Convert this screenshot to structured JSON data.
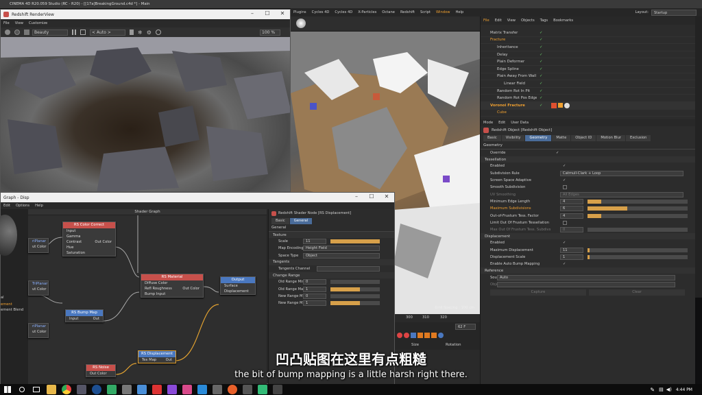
{
  "c4d": {
    "title": "CINEMA 4D R20.059 Studio (RC - R20) - [[17a]BreakingGround.c4d *] - Main",
    "menu": [
      "Plugins",
      "Cycles 4D",
      "Cycles 4D",
      "X-Particles",
      "Octane",
      "Redshift",
      "Script",
      "Window",
      "Help"
    ],
    "layout_label": "Layout:",
    "layout_value": "Startup",
    "grid_spacing": "Grid Spacing : 100 cm"
  },
  "renderview": {
    "title": "Redshift RenderView",
    "menu": [
      "File",
      "View",
      "Customize"
    ],
    "aov": "Beauty",
    "camera": "< Auto >",
    "zoom": "100 %"
  },
  "object_manager": {
    "menu": [
      "File",
      "Edit",
      "View",
      "Objects",
      "Tags",
      "Bookmarks"
    ],
    "objects": [
      {
        "name": "Matrix Transfer"
      },
      {
        "name": "Fracture"
      },
      {
        "name": "Inheritance"
      },
      {
        "name": "Delay"
      },
      {
        "name": "Plain Deformer"
      },
      {
        "name": "Edge Spline"
      },
      {
        "name": "Plain Away From Wall"
      },
      {
        "name": "Linear Field"
      },
      {
        "name": "Random Rot In Pit"
      },
      {
        "name": "Random Rot Pos Edge"
      },
      {
        "name": "Voronoi Fracture"
      },
      {
        "name": "Cube"
      }
    ]
  },
  "attributes": {
    "menu": [
      "Mode",
      "Edit",
      "User Data"
    ],
    "object_title": "Redshift Object [Redshift Object]",
    "tabs": [
      "Basic",
      "Visibility",
      "Geometry",
      "Matte",
      "Object ID",
      "Motion Blur",
      "Exclusion"
    ],
    "section": "Geometry",
    "override": "Override",
    "tessellation_header": "Tessellation",
    "tess_rows": [
      {
        "label": "Enabled",
        "value": "✓"
      },
      {
        "label": "Subdivision Rule",
        "value": "Catmull-Clark + Loop"
      },
      {
        "label": "Screen Space Adaptive",
        "value": "✓"
      },
      {
        "label": "Smooth Subdivision",
        "value": ""
      },
      {
        "label": "UV Smoothing",
        "value": "All Edges"
      },
      {
        "label": "Minimum Edge Length",
        "value": "4"
      },
      {
        "label": "Maximum Subdivisions",
        "value": "6"
      },
      {
        "label": "Out-of-Frustum Tess. Factor",
        "value": "4"
      },
      {
        "label": "Limit Out Of Frustum Tessellation",
        "value": ""
      },
      {
        "label": "Max Out Of Frustum Tess. Subdivs",
        "value": "0"
      }
    ],
    "displacement_header": "Displacement",
    "disp_rows": [
      {
        "label": "Enabled",
        "value": "✓"
      },
      {
        "label": "Maximum Displacement",
        "value": "11"
      },
      {
        "label": "Displacement Scale",
        "value": "1"
      },
      {
        "label": "Enable Auto Bump Mapping",
        "value": "✓"
      }
    ],
    "reference_header": "Reference",
    "ref_source_label": "Source",
    "ref_source_value": "Auto",
    "ref_object_label": "Object",
    "capture": "Capture",
    "clear": "Clear"
  },
  "shader_graph": {
    "title": "Graph - Disp",
    "menu": [
      "Edit",
      "Options",
      "Help"
    ],
    "panel_title": "Shader Graph",
    "left_labels": [
      "riPlanar",
      "ut Color",
      "TriPlanar",
      "ut Color",
      "riPlanar",
      "ut Color"
    ],
    "side_labels": [
      "al",
      "ement",
      "ement Blend"
    ],
    "nodes": {
      "color_correct": {
        "title": "RS Color Correct",
        "ports": [
          "Input",
          "Gamma",
          "Contrast",
          "Hue",
          "Saturation"
        ],
        "out": "Out Color"
      },
      "material": {
        "title": "RS Material",
        "ports": [
          "Diffuse Color",
          "Refl Roughness",
          "Bump Input"
        ],
        "out": "Out Color"
      },
      "output": {
        "title": "Output",
        "ports": [
          "Surface",
          "Displacement"
        ]
      },
      "bump_map": {
        "title": "RS Bump Map",
        "ports": [
          "Input"
        ],
        "out": "Out"
      },
      "displacement": {
        "title": "RS Displacement",
        "ports": [
          "Tex Map"
        ],
        "out": "Out"
      },
      "noise": {
        "title": "RS Noise",
        "out": "Out Color"
      }
    },
    "node_panel": {
      "title": "Redshift Shader Node [RS Displacement]",
      "tabs": [
        "Basic",
        "General"
      ],
      "section": "General",
      "texture_header": "Texture",
      "scale_label": "Scale",
      "scale_value": "11",
      "map_encoding_label": "Map Encoding",
      "map_encoding_value": "Height Field",
      "space_type_label": "Space Type",
      "space_type_value": "Object",
      "tangents_header": "Tangents",
      "tangents_channel": "Tangents Channel",
      "change_range_header": "Change Range",
      "range_rows": [
        {
          "label": "Old Range Min",
          "value": "0"
        },
        {
          "label": "Old Range Max",
          "value": "1"
        },
        {
          "label": "New Range Min",
          "value": "0"
        },
        {
          "label": "New Range Max",
          "value": "1"
        }
      ]
    }
  },
  "timeline": {
    "frames": [
      "300",
      "310",
      "320"
    ],
    "current_frame": "62 F",
    "size_label": "Size",
    "rotation_label": "Rotation"
  },
  "subtitles": {
    "chinese": "凹凸贴图在这里有点粗糙",
    "english": "the bit of bump mapping is a little harsh right there."
  },
  "taskbar": {
    "time": "4:44 PM"
  },
  "colors": {
    "accent_orange": "#f0a030",
    "tab_blue": "#4a6c9a",
    "node_red": "#c7504b",
    "node_blue": "#4a78c0",
    "check_green": "#6ed36e"
  }
}
